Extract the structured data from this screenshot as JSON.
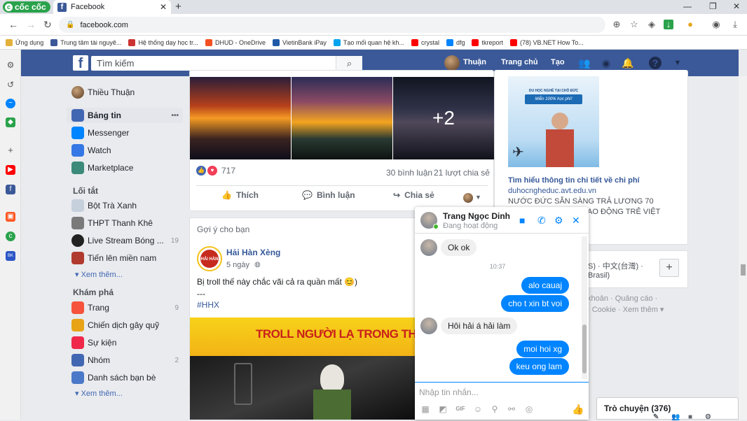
{
  "browser": {
    "brand": "cốc cốc",
    "tab_title": "Facebook",
    "url": "facebook.com",
    "bookmarks": [
      {
        "label": "Ứng dụng",
        "color": "#e3b13a"
      },
      {
        "label": "Trung tâm tài nguyê...",
        "color": "#3b5998"
      },
      {
        "label": "Hệ thống dạy học tr...",
        "color": "#cc3333"
      },
      {
        "label": "DHUD - OneDrive",
        "color": "#f25022"
      },
      {
        "label": "VietinBank iPay",
        "color": "#1e5aa8"
      },
      {
        "label": "Tạo mối quan hệ kh...",
        "color": "#00a4ef"
      },
      {
        "label": "crystal",
        "color": "#ff0000"
      },
      {
        "label": "dfg",
        "color": "#0084ff"
      },
      {
        "label": "tkreport",
        "color": "#ff0000"
      },
      {
        "label": "(78) VB.NET How To...",
        "color": "#ff0000"
      }
    ]
  },
  "fb_header": {
    "search_placeholder": "Tìm kiếm",
    "user_name": "Thuận",
    "home": "Trang chủ",
    "create": "Tạo"
  },
  "left_nav": {
    "profile_name": "Thiều Thuận",
    "main": [
      {
        "label": "Bảng tin",
        "icon": "newsfeed-icon",
        "color": "#4267b2"
      },
      {
        "label": "Messenger",
        "icon": "messenger-icon",
        "color": "#0084ff"
      },
      {
        "label": "Watch",
        "icon": "watch-icon",
        "color": "#3578e5"
      },
      {
        "label": "Marketplace",
        "icon": "marketplace-icon",
        "color": "#3b8a7a"
      }
    ],
    "shortcuts_title": "Lối tắt",
    "shortcuts": [
      {
        "label": "Bột Trà Xanh",
        "count": ""
      },
      {
        "label": "THPT Thanh Khê",
        "count": ""
      },
      {
        "label": "Live Stream Bóng ...",
        "count": "19"
      },
      {
        "label": "Tiến lên miền nam",
        "count": ""
      }
    ],
    "see_more": "Xem thêm...",
    "explore_title": "Khám phá",
    "explore": [
      {
        "label": "Trang",
        "count": "9",
        "color": "#f5533d"
      },
      {
        "label": "Chiến dịch gây quỹ",
        "count": "",
        "color": "#e8a317"
      },
      {
        "label": "Sự kiện",
        "count": "",
        "color": "#f02849"
      },
      {
        "label": "Nhóm",
        "count": "2",
        "color": "#4267b2"
      },
      {
        "label": "Danh sách bạn bè",
        "count": "",
        "color": "#4b79c9"
      }
    ],
    "see_more_2": "Xem thêm..."
  },
  "post1": {
    "photo_more": "+2",
    "reactions": "717",
    "comments": "30 bình luận",
    "shares": "21 lượt chia sẻ",
    "like": "Thích",
    "comment": "Bình luận",
    "share": "Chia sẻ"
  },
  "suggested": {
    "title": "Gợi ý cho bạn",
    "page_name": "Hải Hàn Xèng",
    "time": "5 ngày",
    "text": "Bị troll thế này chắc vãi cả ra quần mất 😊)",
    "dashes": "---",
    "hashtag": "#HHX",
    "banner": "TROLL NGƯỜI LẠ TRONG THANG M",
    "logo_text": "HẢI HÀN XÈNG"
  },
  "ad": {
    "image_banner": "DU HỌC NGHỀ TẠI CHỖ ĐỨC",
    "image_sub": "Miễn 100% học phí!",
    "title": "Tìm hiểu thông tin chi tiết về chi phí",
    "domain": "duhocngheduc.avt.edu.vn",
    "desc1": "NƯỚC ĐỨC SẴN SÀNG TRẢ LƯƠNG 70",
    "desc2": "AO ĐỘNG TRẺ VIỆT"
  },
  "languages": {
    "lang_tail": "S) · 中文(台灣) ·",
    "lang2": "Brasil)",
    "footer1": "khoản · Quảng cáo ·",
    "footer2": "· Cookie · Xem thêm ▾"
  },
  "chat": {
    "name": "Trang Ngọc Dinh",
    "status": "Đang hoạt động",
    "messages_in": [
      "Ok ok",
      "Hôi hải á hải làm"
    ],
    "timestamp": "10:37",
    "messages_out": [
      "alo cauaj",
      "cho t xin bt voi",
      "moi hoi xg",
      "keu ong lam"
    ],
    "input_placeholder": "Nhập tin nhắn..."
  },
  "chat_list": {
    "label": "Trò chuyện (376)"
  }
}
